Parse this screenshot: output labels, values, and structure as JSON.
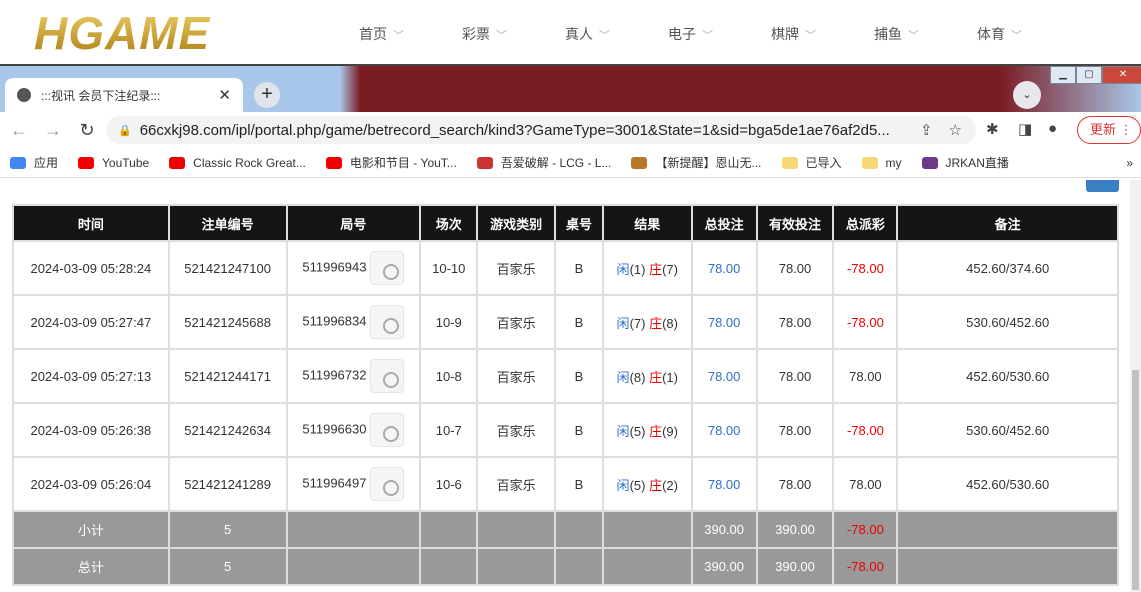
{
  "site": {
    "logo": "HGAME",
    "nav": [
      "首页",
      "彩票",
      "真人",
      "电子",
      "棋牌",
      "捕鱼",
      "体育"
    ]
  },
  "browser": {
    "tab_title": ":::视讯 会员下注纪录:::",
    "url": "66cxkj98.com/ipl/portal.php/game/betrecord_search/kind3?GameType=3001&State=1&sid=bga5de1ae76af2d5...",
    "update_label": "更新",
    "bookmarks": [
      "应用",
      "YouTube",
      "Classic Rock Great...",
      "电影和节目 - YouT...",
      "吾爱破解 - LCG - L...",
      "【新提醒】恩山无...",
      "已导入",
      "my",
      "JRKAN直播"
    ]
  },
  "table": {
    "headers": [
      "时间",
      "注单编号",
      "局号",
      "场次",
      "游戏类别",
      "桌号",
      "结果",
      "总投注",
      "有效投注",
      "总派彩",
      "备注"
    ],
    "rows": [
      {
        "time": "2024-03-09 05:28:24",
        "bet_id": "521421247100",
        "round": "511996943",
        "session": "10-10",
        "game": "百家乐",
        "table": "B",
        "player": "闲",
        "player_n": "(1)",
        "banker": "庄",
        "banker_n": "(7)",
        "total": "78.00",
        "valid": "78.00",
        "payout": "-78.00",
        "payout_color": "red",
        "note": "452.60/374.60"
      },
      {
        "time": "2024-03-09 05:27:47",
        "bet_id": "521421245688",
        "round": "511996834",
        "session": "10-9",
        "game": "百家乐",
        "table": "B",
        "player": "闲",
        "player_n": "(7)",
        "banker": "庄",
        "banker_n": "(8)",
        "total": "78.00",
        "valid": "78.00",
        "payout": "-78.00",
        "payout_color": "red",
        "note": "530.60/452.60"
      },
      {
        "time": "2024-03-09 05:27:13",
        "bet_id": "521421244171",
        "round": "511996732",
        "session": "10-8",
        "game": "百家乐",
        "table": "B",
        "player": "闲",
        "player_n": "(8)",
        "banker": "庄",
        "banker_n": "(1)",
        "total": "78.00",
        "valid": "78.00",
        "payout": "78.00",
        "payout_color": "black",
        "note": "452.60/530.60"
      },
      {
        "time": "2024-03-09 05:26:38",
        "bet_id": "521421242634",
        "round": "511996630",
        "session": "10-7",
        "game": "百家乐",
        "table": "B",
        "player": "闲",
        "player_n": "(5)",
        "banker": "庄",
        "banker_n": "(9)",
        "total": "78.00",
        "valid": "78.00",
        "payout": "-78.00",
        "payout_color": "red",
        "note": "530.60/452.60"
      },
      {
        "time": "2024-03-09 05:26:04",
        "bet_id": "521421241289",
        "round": "511996497",
        "session": "10-6",
        "game": "百家乐",
        "table": "B",
        "player": "闲",
        "player_n": "(5)",
        "banker": "庄",
        "banker_n": "(2)",
        "total": "78.00",
        "valid": "78.00",
        "payout": "78.00",
        "payout_color": "black",
        "note": "452.60/530.60"
      }
    ],
    "subtotal": {
      "label": "小计",
      "count": "5",
      "total": "390.00",
      "valid": "390.00",
      "payout": "-78.00"
    },
    "grand_total": {
      "label": "总计",
      "count": "5",
      "total": "390.00",
      "valid": "390.00",
      "payout": "-78.00"
    }
  }
}
